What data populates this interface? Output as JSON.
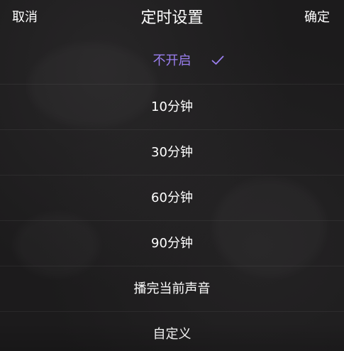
{
  "header": {
    "cancel_label": "取消",
    "title": "定时设置",
    "confirm_label": "确定"
  },
  "options": [
    {
      "label": "不开启",
      "selected": true
    },
    {
      "label": "10分钟",
      "selected": false
    },
    {
      "label": "30分钟",
      "selected": false
    },
    {
      "label": "60分钟",
      "selected": false
    },
    {
      "label": "90分钟",
      "selected": false
    },
    {
      "label": "播完当前声音",
      "selected": false
    },
    {
      "label": "自定义",
      "selected": false
    }
  ],
  "colors": {
    "selected_accent": "#9b7ff0",
    "text": "#ffffff",
    "background": "#1c1b1c"
  },
  "icons": {
    "selected_marker": "check-icon"
  }
}
